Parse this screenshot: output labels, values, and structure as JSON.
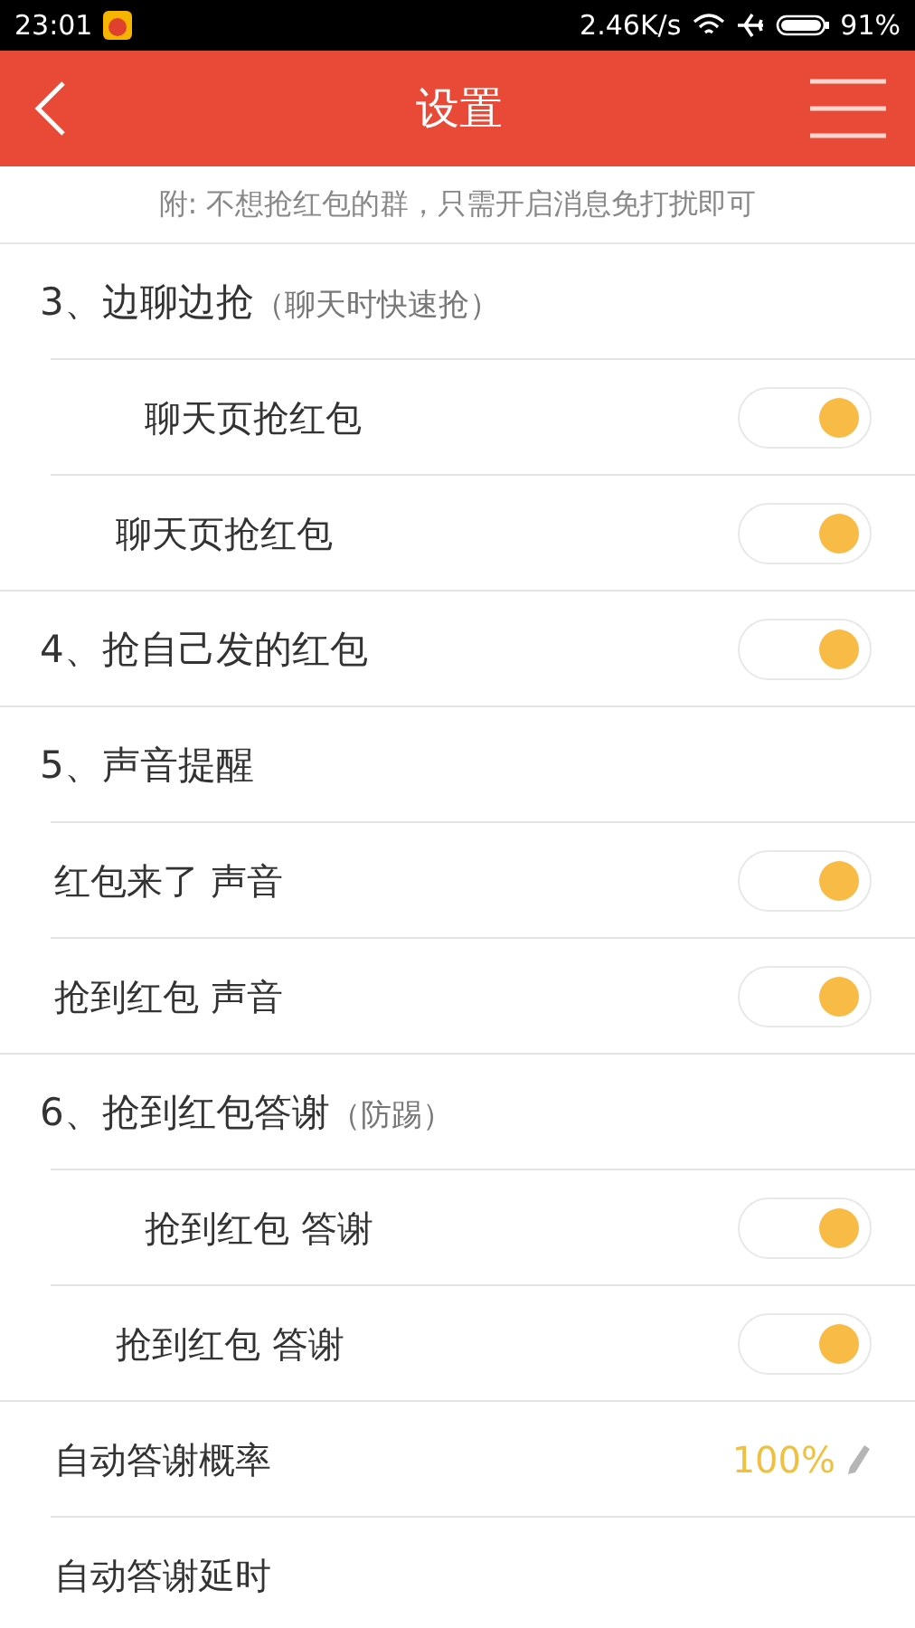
{
  "status_bar": {
    "time": "23:01",
    "speed": "2.46K/s",
    "battery": "91%"
  },
  "header": {
    "title": "设置"
  },
  "notice": "附: 不想抢红包的群，只需开启消息免打扰即可",
  "sections": [
    {
      "title": "3、边聊边抢",
      "note": "（聊天时快速抢）",
      "items": [
        {
          "kind": "toggle-deep",
          "label": "聊天页抢红包",
          "on": true
        },
        {
          "kind": "toggle-mid",
          "label": "聊天页抢红包",
          "on": true
        }
      ]
    },
    {
      "title": "4、抢自己发的红包",
      "toggle": {
        "on": true
      }
    },
    {
      "title": "5、声音提醒",
      "items": [
        {
          "kind": "toggle",
          "label": "红包来了 声音",
          "on": true
        },
        {
          "kind": "toggle",
          "label": "抢到红包 声音",
          "on": true
        }
      ]
    },
    {
      "title": "6、抢到红包答谢",
      "note": "（防踢）",
      "items": [
        {
          "kind": "toggle-deep",
          "label": "抢到红包 答谢",
          "on": true
        },
        {
          "kind": "toggle-mid",
          "label": "抢到红包 答谢",
          "on": true
        }
      ]
    },
    {
      "items": [
        {
          "kind": "value",
          "label": "自动答谢概率",
          "value": "100%"
        },
        {
          "kind": "value",
          "label": "自动答谢延时"
        }
      ]
    }
  ]
}
